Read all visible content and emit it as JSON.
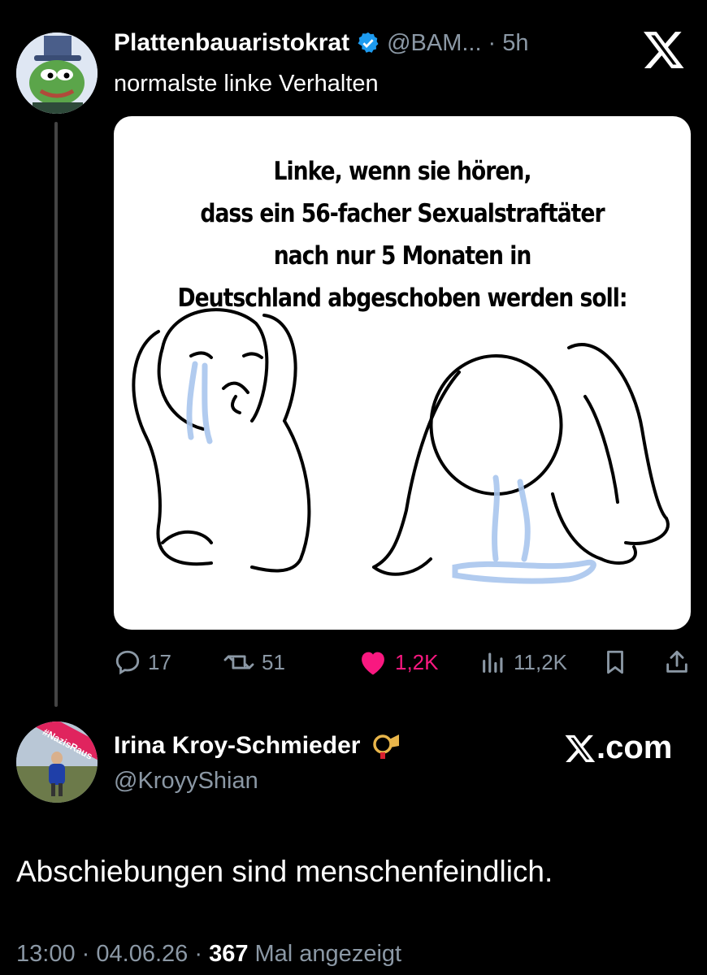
{
  "tweet": {
    "author_name": "Plattenbauaristokrat",
    "handle": "@BAM...",
    "separator": "·",
    "time": "5h",
    "text": "normalste linke Verhalten",
    "verified_color": "#1d9bf0",
    "meme_caption": [
      "Linke, wenn sie hören,",
      "dass ein 56-facher Sexualstraftäter",
      "nach nur 5 Monaten in",
      "Deutschland abgeschoben werden soll:"
    ],
    "actions": {
      "replies": "17",
      "reposts": "51",
      "likes": "1,2K",
      "views": "11,2K"
    },
    "like_color": "#f91880"
  },
  "reply": {
    "author_name": "Irina Kroy-Schmieder",
    "handle": "@KroyyShian",
    "avatar_banner": "#NazisRaus",
    "badge": "posthorn-icon",
    "source_label": "X.com",
    "text": "Abschiebungen sind menschenfeindlich.",
    "time": "13:00",
    "date": "04.06.26",
    "views_count": "367",
    "views_label": "Mal angezeigt"
  }
}
